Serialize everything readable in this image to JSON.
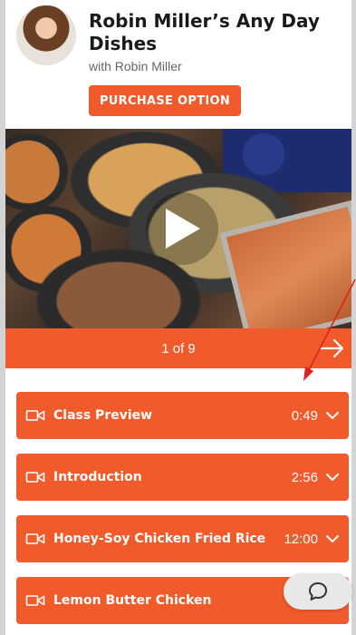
{
  "course": {
    "title": "Robin Miller’s Any Day Dishes",
    "subtitle": "with Robin Miller",
    "purchase_label": "PURCHASE OPTION"
  },
  "video": {
    "pager": "1 of 9"
  },
  "lessons": [
    {
      "title": "Class Preview",
      "duration": "0:49"
    },
    {
      "title": "Introduction",
      "duration": "2:56"
    },
    {
      "title": "Honey-Soy Chicken Fried Rice",
      "duration": "12:00"
    },
    {
      "title": "Lemon Butter Chicken",
      "duration": ""
    }
  ],
  "colors": {
    "accent": "#f15a2b",
    "annotation_arrow": "#e0201c"
  },
  "icons": {
    "play": "play-icon",
    "next": "arrow-right-icon",
    "lesson": "video-camera-icon",
    "expand": "chevron-down-icon",
    "chat": "chat-bubble-icon"
  }
}
